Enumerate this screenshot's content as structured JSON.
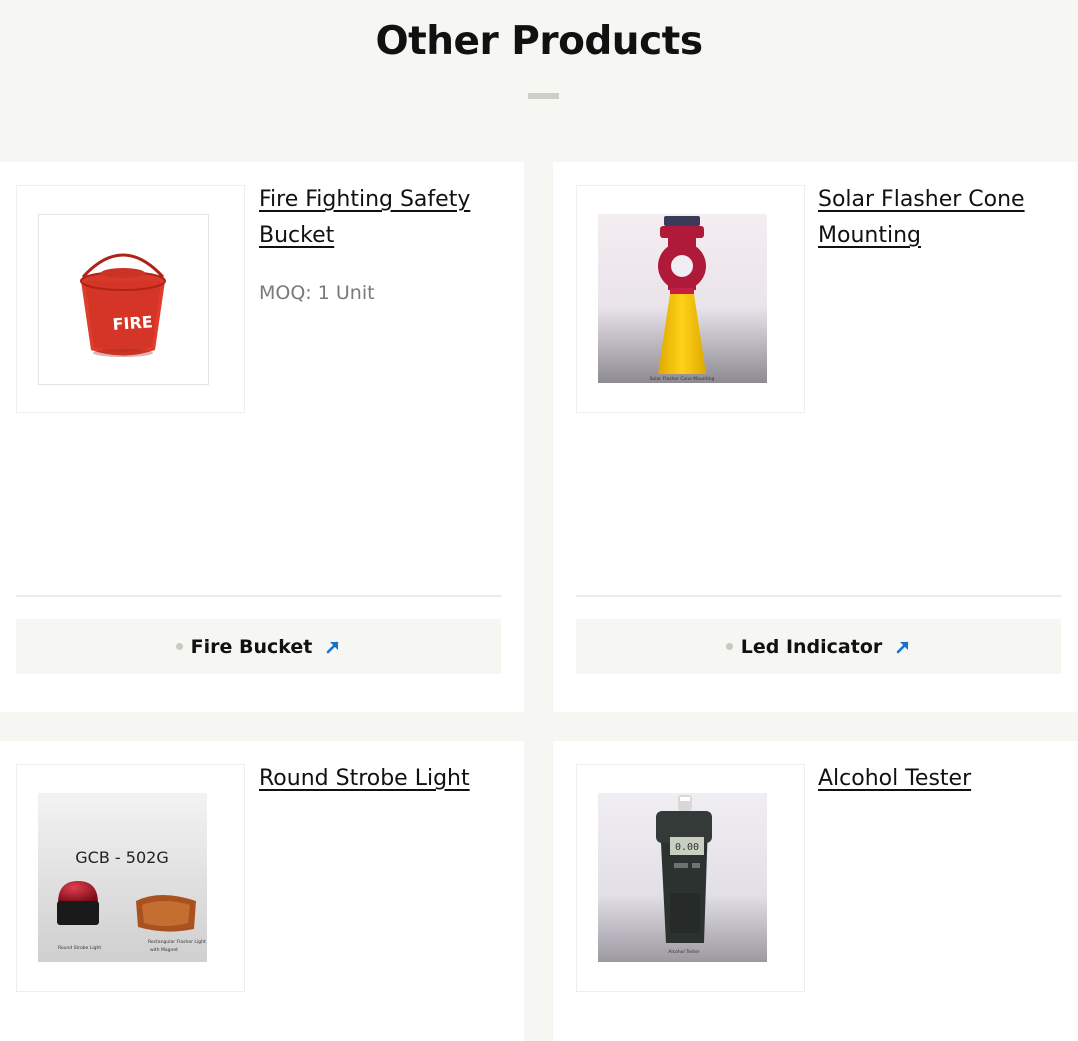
{
  "section": {
    "title": "Other Products"
  },
  "products": [
    {
      "name": "Fire Fighting Safety Bucket",
      "moq": "MOQ: 1 Unit",
      "category": "Fire Bucket",
      "image_icon": "fire-bucket-image"
    },
    {
      "name": "Solar Flasher Cone Mounting",
      "moq": "",
      "category": "Led Indicator",
      "image_icon": "solar-flasher-cone-image",
      "image_caption": "Solar Flasher Cone Mounting"
    },
    {
      "name": "Round Strobe Light",
      "moq": "",
      "category": "",
      "image_icon": "round-strobe-light-image",
      "image_text": "GCB - 502G",
      "image_caption_left": "Round Strobe Light",
      "image_caption_right": "Rectangular Flasher Light with Magnet"
    },
    {
      "name": "Alcohol Tester",
      "moq": "",
      "category": "",
      "image_icon": "alcohol-tester-image",
      "image_caption": "Alcohol Tester"
    }
  ],
  "colors": {
    "page_bg": "#f6f6f2",
    "card_bg": "#ffffff",
    "arrow_accent": "#1a73c9",
    "muted_text": "#7a7a7a"
  }
}
